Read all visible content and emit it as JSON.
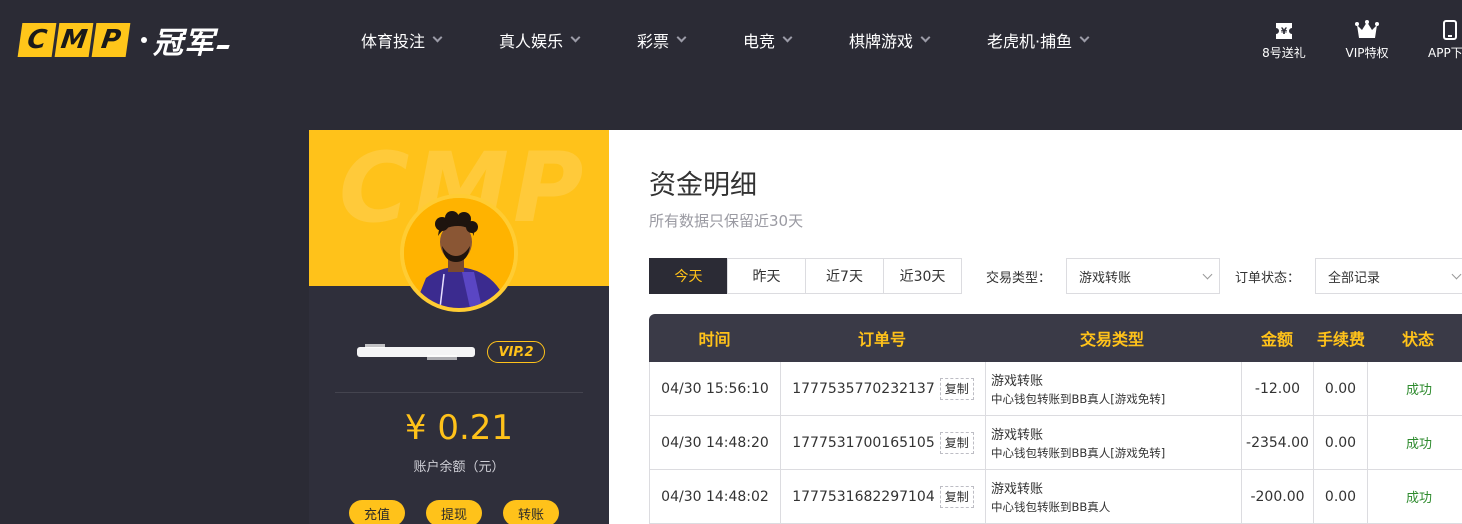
{
  "header": {
    "logo_letters": [
      "C",
      "M",
      "P"
    ],
    "logo_cn": "冠军",
    "nav": [
      {
        "label": "体育投注"
      },
      {
        "label": "真人娱乐"
      },
      {
        "label": "彩票"
      },
      {
        "label": "电竞"
      },
      {
        "label": "棋牌游戏"
      },
      {
        "label": "老虎机·捕鱼"
      }
    ],
    "right_items": [
      {
        "label": "8号送礼",
        "icon": "ticket-icon"
      },
      {
        "label": "VIP特权",
        "icon": "crown-icon"
      },
      {
        "label": "APP下",
        "icon": "phone-icon"
      }
    ]
  },
  "profile": {
    "banner_watermark": "CMP",
    "vip_level": "VIP.2",
    "balance": "¥ 0.21",
    "balance_label": "账户余额（元）",
    "buttons": [
      "充值",
      "提现",
      "转账"
    ]
  },
  "main": {
    "title": "资金明细",
    "subtitle": "所有数据只保留近30天",
    "tabs": [
      {
        "label": "今天",
        "active": true
      },
      {
        "label": "昨天",
        "active": false
      },
      {
        "label": "近7天",
        "active": false
      },
      {
        "label": "近30天",
        "active": false
      }
    ],
    "filters": {
      "type_label": "交易类型：",
      "type_value": "游戏转账",
      "status_label": "订单状态：",
      "status_value": "全部记录"
    },
    "table": {
      "headers": [
        "时间",
        "订单号",
        "交易类型",
        "金额",
        "手续费",
        "状态"
      ],
      "copy_label": "复制",
      "rows": [
        {
          "time": "04/30 15:56:10",
          "order": "1777535770232137",
          "type": "游戏转账",
          "type_detail": "中心钱包转账到BB真人[游戏免转]",
          "amount": "-12.00",
          "fee": "0.00",
          "status": "成功"
        },
        {
          "time": "04/30 14:48:20",
          "order": "1777531700165105",
          "type": "游戏转账",
          "type_detail": "中心钱包转账到BB真人[游戏免转]",
          "amount": "-2354.00",
          "fee": "0.00",
          "status": "成功"
        },
        {
          "time": "04/30 14:48:02",
          "order": "1777531682297104",
          "type": "游戏转账",
          "type_detail": "中心钱包转账到BB真人",
          "amount": "-200.00",
          "fee": "0.00",
          "status": "成功"
        }
      ]
    }
  },
  "colors": {
    "accent": "#ffc21a",
    "dark_bg": "#2b2b35",
    "table_header": "#3a3a47",
    "success": "#2e8b2e"
  }
}
